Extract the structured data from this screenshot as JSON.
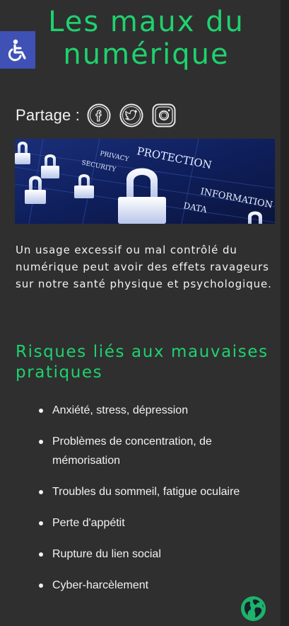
{
  "page": {
    "title": "Les maux du numérique"
  },
  "accessibility": {
    "icon": "wheelchair-icon",
    "color": "#3f51b5"
  },
  "share": {
    "label": "Partage :",
    "icons": [
      "facebook-icon",
      "twitter-icon",
      "instagram-icon"
    ]
  },
  "banner": {
    "words": [
      "PROTECTION",
      "PRIVACY",
      "SECURITY",
      "INFORMATION",
      "DATA"
    ]
  },
  "intro": {
    "text": "Un usage excessif ou mal contrôlé du numérique peut avoir des effets ravageurs sur notre santé physique et psychologique."
  },
  "risks": {
    "title": "Risques liés aux mauvaises pratiques",
    "items": [
      "Anxiété, stress, dépression",
      "Problèmes de concentration, de mémorisation",
      "Troubles du sommeil, fatigue oculaire",
      "Perte d'appétit",
      "Rupture du lien social",
      "Cyber-harcèlement"
    ]
  },
  "colors": {
    "accent": "#1ed26e",
    "background": "#2f2f2f",
    "text": "#f2f2f2"
  },
  "language_button": {
    "icon": "globe-icon"
  }
}
